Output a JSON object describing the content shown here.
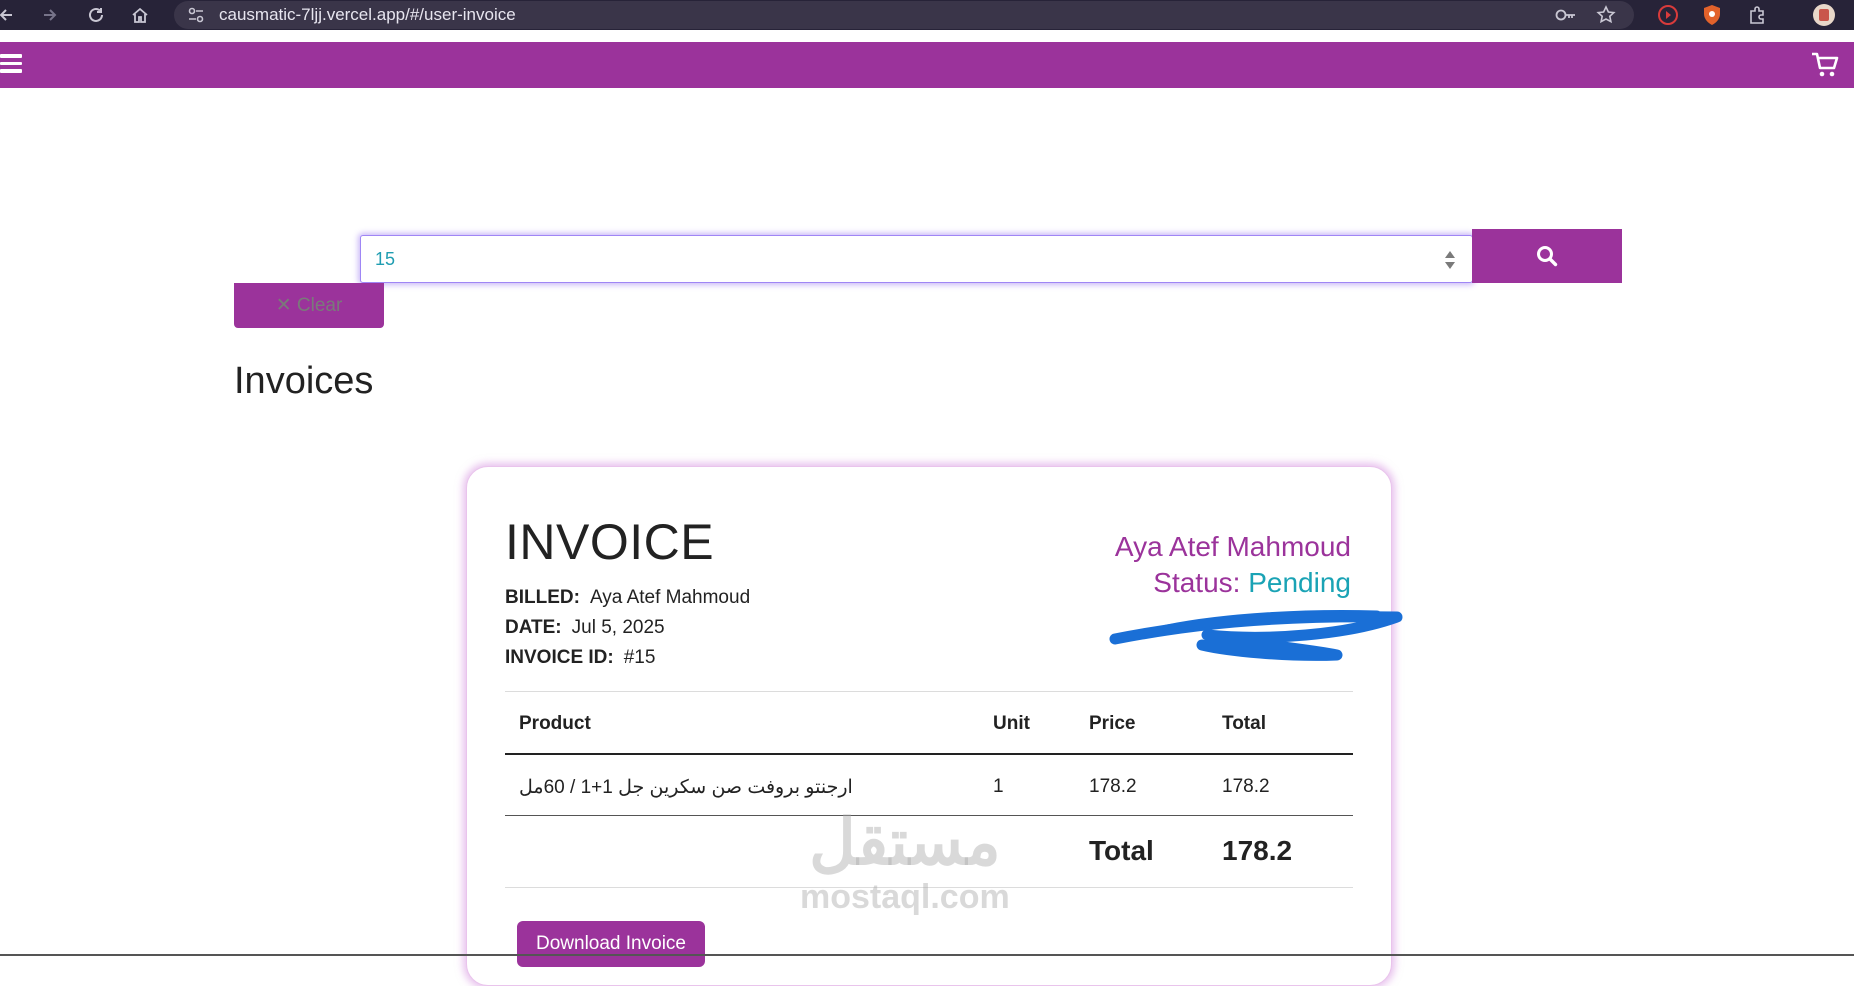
{
  "browser": {
    "url": "causmatic-7ljj.vercel.app/#/user-invoice"
  },
  "search": {
    "value": "15",
    "clear_label": "✕ Clear"
  },
  "page": {
    "title": "Invoices"
  },
  "invoice": {
    "heading": "INVOICE",
    "billed_label": "BILLED:",
    "billed_value": "Aya Atef Mahmoud",
    "date_label": "DATE:",
    "date_value": "Jul 5, 2025",
    "id_label": "INVOICE ID:",
    "id_value": "#15",
    "customer_name": "Aya Atef Mahmoud",
    "status_label": "Status:",
    "status_value": "Pending",
    "table": {
      "headers": [
        "Product",
        "Unit",
        "Price",
        "Total"
      ],
      "rows": [
        [
          "ارجنتو بروفت صن سكرين جل 1+1 / 60مل",
          "1",
          "178.2",
          "178.2"
        ]
      ],
      "total_label": "Total",
      "total_value": "178.2"
    },
    "download_label": "Download Invoice"
  },
  "watermark": {
    "arabic": "مستقل",
    "latin": "mostaql.com"
  },
  "colors": {
    "brand": "#9b339b",
    "status": "#1aa3b5",
    "browser_bar": "#272338"
  },
  "icons": [
    "back-arrow-icon",
    "forward-arrow-icon",
    "reload-icon",
    "home-icon",
    "site-settings-icon",
    "key-icon",
    "star-icon",
    "extension-icons",
    "hamburger-icon",
    "cart-icon",
    "search-icon",
    "close-icon"
  ]
}
